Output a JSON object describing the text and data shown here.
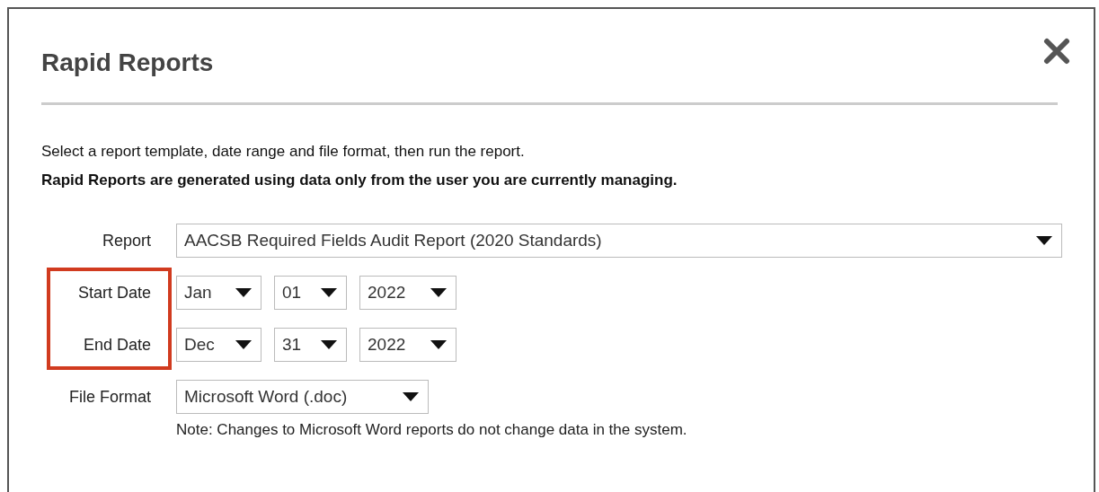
{
  "dialog": {
    "title": "Rapid Reports"
  },
  "intro": "Select a report template, date range and file format, then run the report.",
  "notice": "Rapid Reports are generated using data only from the user you are currently managing.",
  "report": {
    "label": "Report",
    "value": "AACSB Required Fields Audit Report (2020 Standards)"
  },
  "date_range": {
    "highlighted": true,
    "rows": [
      {
        "label": "Start Date",
        "month": "Jan",
        "day": "01",
        "year": "2022"
      },
      {
        "label": "End Date",
        "month": "Dec",
        "day": "31",
        "year": "2022"
      }
    ]
  },
  "file_format": {
    "label": "File Format",
    "value": "Microsoft Word (.doc)",
    "note": "Note: Changes to Microsoft Word reports do not change data in the system."
  }
}
